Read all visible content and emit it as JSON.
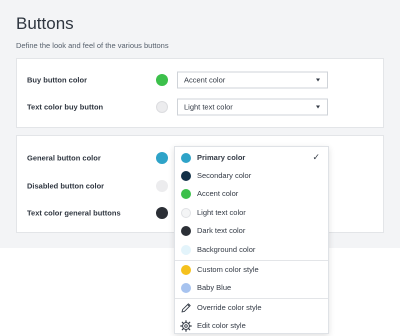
{
  "page": {
    "title": "Buttons",
    "subtitle": "Define the look and feel of the various buttons"
  },
  "card1": {
    "rows": [
      {
        "label": "Buy button color",
        "swatch": "#3cc04b",
        "swatch_border": "",
        "value": "Accent color"
      },
      {
        "label": "Text color buy button",
        "swatch": "#ececee",
        "swatch_border": "#dcdde0",
        "value": "Light text color"
      }
    ]
  },
  "card2": {
    "rows": [
      {
        "label": "General button color",
        "swatch": "#2ea3c8"
      },
      {
        "label": "Disabled button color",
        "swatch": "#ececee"
      },
      {
        "label": "Text color general buttons",
        "swatch": "#2b2f36"
      }
    ]
  },
  "dropdown": {
    "selected_index": 0,
    "colors": [
      {
        "label": "Primary color",
        "color": "#2ea3c8"
      },
      {
        "label": "Secondary color",
        "color": "#123047"
      },
      {
        "label": "Accent color",
        "color": "#3cc04b"
      },
      {
        "label": "Light text color",
        "color": "#f4f5f6"
      },
      {
        "label": "Dark text color",
        "color": "#2b2f36"
      },
      {
        "label": "Background color",
        "color": "#e3f4fb"
      }
    ],
    "custom": [
      {
        "label": "Custom color style",
        "color": "#f5c11d"
      },
      {
        "label": "Baby Blue",
        "color": "#a7c3ef"
      }
    ],
    "actions": [
      {
        "label": "Override color style",
        "icon": "pencil-icon"
      },
      {
        "label": "Edit color style",
        "icon": "gear-icon"
      }
    ]
  }
}
